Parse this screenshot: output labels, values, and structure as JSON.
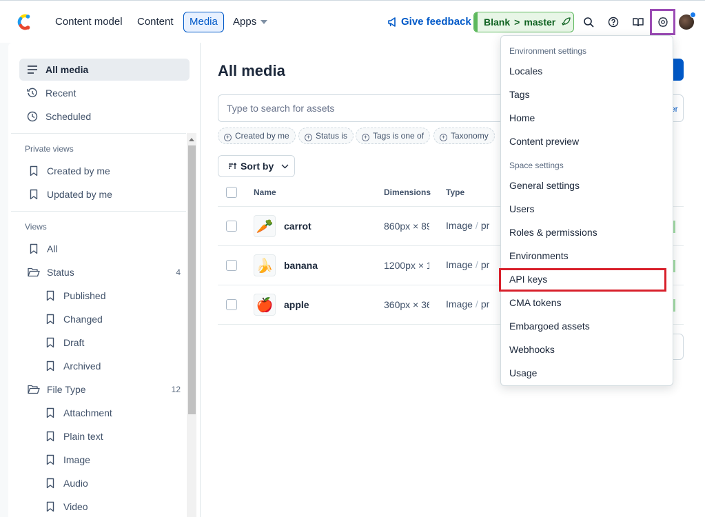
{
  "topbar": {
    "nav": [
      {
        "label": "Content model"
      },
      {
        "label": "Content"
      },
      {
        "label": "Media"
      },
      {
        "label": "Apps"
      }
    ],
    "feedback_label": "Give feedback",
    "environment": {
      "space": "Blank",
      "separator": ">",
      "branch": "master"
    },
    "icons": [
      "search-icon",
      "help-icon",
      "book-icon",
      "gear-icon",
      "avatar"
    ]
  },
  "sidebar": {
    "top_items": [
      {
        "label": "All media",
        "icon": "list-icon"
      },
      {
        "label": "Recent",
        "icon": "history-icon"
      },
      {
        "label": "Scheduled",
        "icon": "clock-icon"
      }
    ],
    "private_views_heading": "Private views",
    "private_views": [
      {
        "label": "Created by me"
      },
      {
        "label": "Updated by me"
      }
    ],
    "views_heading": "Views",
    "views": {
      "all": "All",
      "status": {
        "label": "Status",
        "count": "4",
        "children": [
          "Published",
          "Changed",
          "Draft",
          "Archived"
        ]
      },
      "file_type": {
        "label": "File Type",
        "count": "12",
        "children": [
          "Attachment",
          "Plain text",
          "Image",
          "Audio",
          "Video"
        ]
      }
    }
  },
  "main": {
    "title": "All media",
    "search_placeholder": "Type to search for assets",
    "search_tail": "er",
    "filters": [
      "Created by me",
      "Status is",
      "Tags is one of",
      "Taxonomy"
    ],
    "sort_label": "Sort by",
    "columns": {
      "name": "Name",
      "dimensions": "Dimensions",
      "type": "Type"
    },
    "assets": [
      {
        "name": "carrot",
        "dimensions": "860px × 89",
        "type": "Image",
        "type2": "pr",
        "emoji": "🥕"
      },
      {
        "name": "banana",
        "dimensions": "1200px × 1",
        "type": "Image",
        "type2": "pr",
        "emoji": "🍌"
      },
      {
        "name": "apple",
        "dimensions": "360px × 36",
        "type": "Image",
        "type2": "pr",
        "emoji": "🍎"
      }
    ],
    "type_separator": "/"
  },
  "dropdown": {
    "environment_heading": "Environment settings",
    "environment_items": [
      "Locales",
      "Tags",
      "Home",
      "Content preview"
    ],
    "space_heading": "Space settings",
    "space_items": [
      "General settings",
      "Users",
      "Roles & permissions",
      "Environments",
      "API keys",
      "CMA tokens",
      "Embargoed assets",
      "Webhooks",
      "Usage"
    ]
  },
  "colors": {
    "primary": "#0059c8",
    "env_green": "#5cb85c",
    "highlight_red": "#d8202b",
    "settings_outline": "#9b4bb4"
  }
}
